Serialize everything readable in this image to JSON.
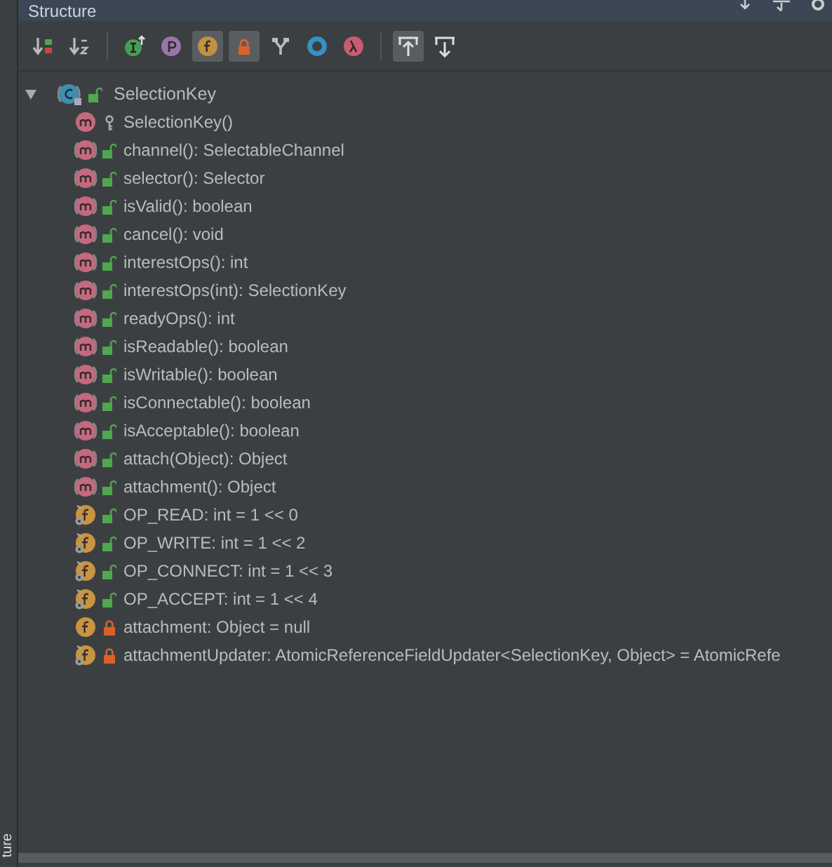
{
  "window": {
    "title": "Structure"
  },
  "toolbar": [
    {
      "kind": "sort-visibility",
      "selected": false
    },
    {
      "kind": "sort-alpha",
      "selected": false
    },
    {
      "kind": "divider"
    },
    {
      "kind": "inherited",
      "selected": false
    },
    {
      "kind": "properties",
      "selected": false
    },
    {
      "kind": "fields",
      "selected": true
    },
    {
      "kind": "non-public",
      "selected": true
    },
    {
      "kind": "hierarchy",
      "selected": false
    },
    {
      "kind": "anonymous",
      "selected": false
    },
    {
      "kind": "lambdas",
      "selected": false
    },
    {
      "kind": "divider"
    },
    {
      "kind": "scroll-to-source",
      "selected": true
    },
    {
      "kind": "scroll-from-source",
      "selected": false
    }
  ],
  "tree": {
    "label": "SelectionKey",
    "kind": "class",
    "public": true,
    "private": false,
    "expanded": true,
    "children": [
      {
        "label": "SelectionKey()",
        "kind": "method",
        "abstract": false,
        "static": false,
        "public": false,
        "private": false
      },
      {
        "label": "channel(): SelectableChannel",
        "kind": "method",
        "abstract": true,
        "static": false,
        "public": true,
        "private": false
      },
      {
        "label": "selector(): Selector",
        "kind": "method",
        "abstract": true,
        "static": false,
        "public": true,
        "private": false
      },
      {
        "label": "isValid(): boolean",
        "kind": "method",
        "abstract": true,
        "static": false,
        "public": true,
        "private": false
      },
      {
        "label": "cancel(): void",
        "kind": "method",
        "abstract": true,
        "static": false,
        "public": true,
        "private": false
      },
      {
        "label": "interestOps(): int",
        "kind": "method",
        "abstract": true,
        "static": false,
        "public": true,
        "private": false
      },
      {
        "label": "interestOps(int): SelectionKey",
        "kind": "method",
        "abstract": true,
        "static": false,
        "public": true,
        "private": false
      },
      {
        "label": "readyOps(): int",
        "kind": "method",
        "abstract": true,
        "static": false,
        "public": true,
        "private": false
      },
      {
        "label": "isReadable(): boolean",
        "kind": "method",
        "abstract": true,
        "static": false,
        "public": true,
        "private": false
      },
      {
        "label": "isWritable(): boolean",
        "kind": "method",
        "abstract": true,
        "static": false,
        "public": true,
        "private": false
      },
      {
        "label": "isConnectable(): boolean",
        "kind": "method",
        "abstract": true,
        "static": false,
        "public": true,
        "private": false
      },
      {
        "label": "isAcceptable(): boolean",
        "kind": "method",
        "abstract": true,
        "static": false,
        "public": true,
        "private": false
      },
      {
        "label": "attach(Object): Object",
        "kind": "method",
        "abstract": true,
        "static": false,
        "public": true,
        "private": false
      },
      {
        "label": "attachment(): Object",
        "kind": "method",
        "abstract": true,
        "static": false,
        "public": true,
        "private": false
      },
      {
        "label": "OP_READ: int = 1 << 0",
        "kind": "field",
        "abstract": false,
        "static": true,
        "public": true,
        "private": false
      },
      {
        "label": "OP_WRITE: int = 1 << 2",
        "kind": "field",
        "abstract": false,
        "static": true,
        "public": true,
        "private": false
      },
      {
        "label": "OP_CONNECT: int = 1 << 3",
        "kind": "field",
        "abstract": false,
        "static": true,
        "public": true,
        "private": false
      },
      {
        "label": "OP_ACCEPT: int = 1 << 4",
        "kind": "field",
        "abstract": false,
        "static": true,
        "public": true,
        "private": false
      },
      {
        "label": "attachment: Object = null",
        "kind": "field",
        "abstract": false,
        "static": false,
        "public": false,
        "private": true
      },
      {
        "label": "attachmentUpdater: AtomicReferenceFieldUpdater<SelectionKey, Object> = AtomicRefe",
        "kind": "field",
        "abstract": false,
        "static": true,
        "public": false,
        "private": true
      }
    ]
  },
  "side_strip": {
    "label": "ture"
  }
}
